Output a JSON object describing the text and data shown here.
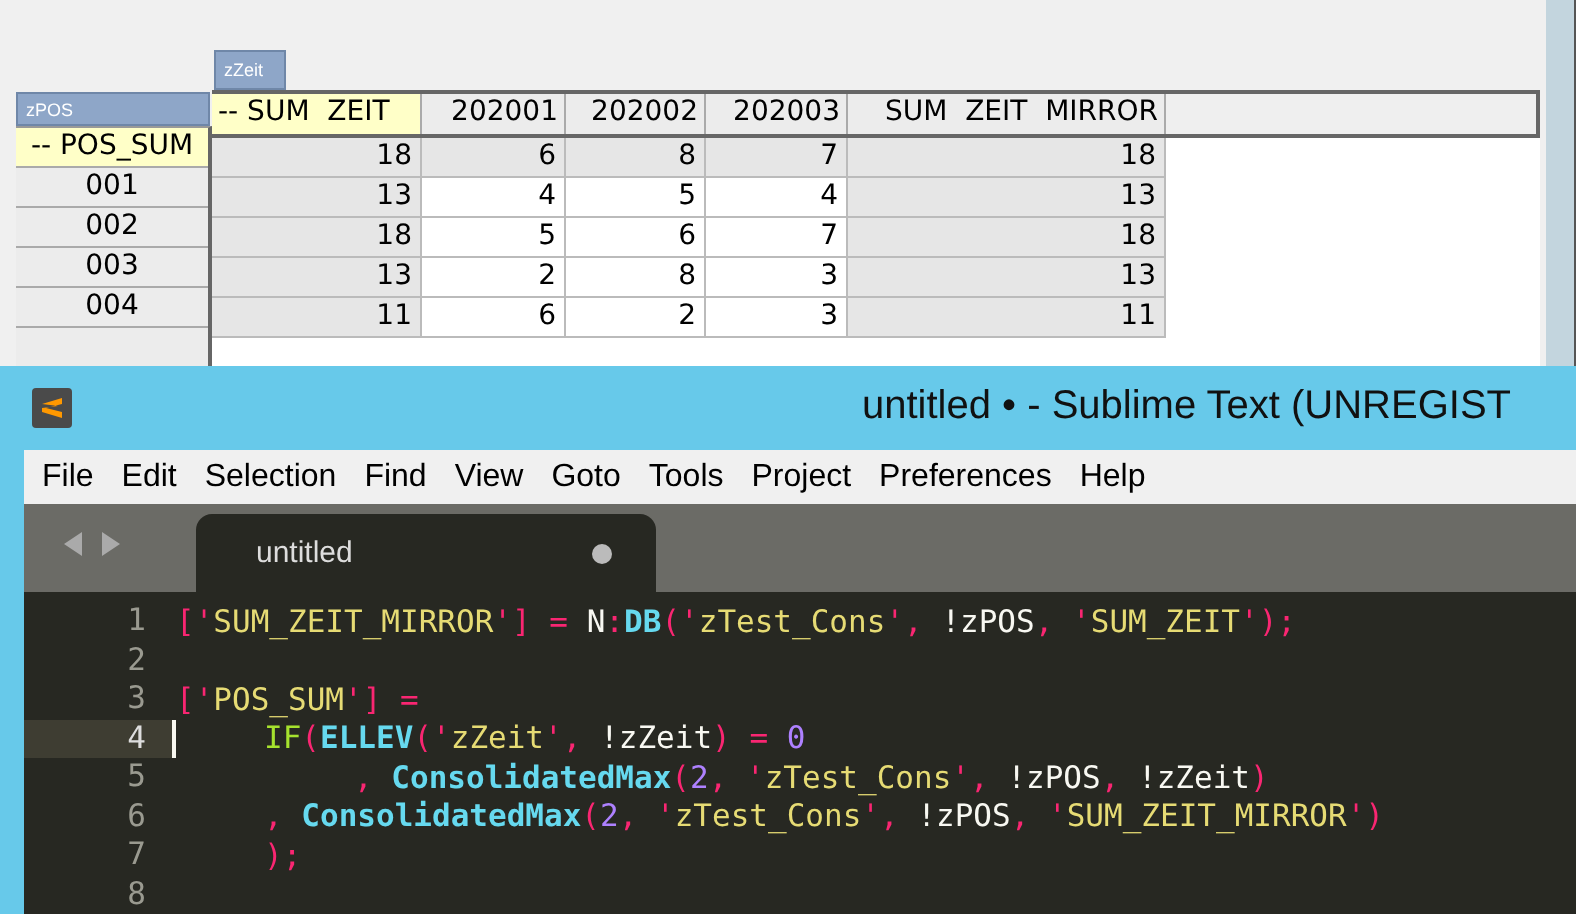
{
  "pivot": {
    "column_dimension": "zZeit",
    "row_dimension": "zPOS",
    "columns": [
      {
        "label": "-- SUM  ZEIT",
        "kind": "total"
      },
      {
        "label": "202001",
        "kind": "leaf"
      },
      {
        "label": "202002",
        "kind": "leaf"
      },
      {
        "label": "202003",
        "kind": "leaf"
      },
      {
        "label": "SUM  ZEIT  MIRROR",
        "kind": "mirror"
      }
    ],
    "rows": [
      {
        "label": "-- POS_SUM",
        "kind": "total",
        "cells": [
          "18",
          "6",
          "8",
          "7",
          "18"
        ]
      },
      {
        "label": "001",
        "kind": "leaf",
        "cells": [
          "13",
          "4",
          "5",
          "4",
          "13"
        ]
      },
      {
        "label": "002",
        "kind": "leaf",
        "cells": [
          "18",
          "5",
          "6",
          "7",
          "18"
        ]
      },
      {
        "label": "003",
        "kind": "leaf",
        "cells": [
          "13",
          "2",
          "8",
          "3",
          "13"
        ]
      },
      {
        "label": "004",
        "kind": "leaf",
        "cells": [
          "11",
          "6",
          "2",
          "3",
          "11"
        ]
      }
    ]
  },
  "editor": {
    "window": {
      "title": "untitled • - Sublime Text (UNREGIST"
    },
    "menu": [
      "File",
      "Edit",
      "Selection",
      "Find",
      "View",
      "Goto",
      "Tools",
      "Project",
      "Preferences",
      "Help"
    ],
    "tabs": [
      {
        "label": "untitled",
        "modified": true,
        "selected": true
      }
    ],
    "lines": [
      {
        "number": "1",
        "current": false,
        "kind": "top",
        "tokens": [
          {
            "t": "['",
            "kind": "punct"
          },
          {
            "t": "SUM_ZEIT_MIRROR",
            "kind": "string"
          },
          {
            "t": "'] = ",
            "kind": "punct"
          },
          {
            "t": "N",
            "kind": "plain"
          },
          {
            "t": ":",
            "kind": "punct"
          },
          {
            "t": "DB",
            "kind": "function"
          },
          {
            "t": "('",
            "kind": "punct"
          },
          {
            "t": "zTest_Cons",
            "kind": "string"
          },
          {
            "t": "', ",
            "kind": "punct"
          },
          {
            "t": "!zPOS",
            "kind": "plain"
          },
          {
            "t": ", '",
            "kind": "punct"
          },
          {
            "t": "SUM_ZEIT",
            "kind": "string"
          },
          {
            "t": "');",
            "kind": "punct"
          }
        ]
      },
      {
        "number": "2",
        "current": false
      },
      {
        "number": "3",
        "current": false,
        "kind": "top",
        "tokens": [
          {
            "t": "['",
            "kind": "punct"
          },
          {
            "t": "POS_SUM",
            "kind": "string"
          },
          {
            "t": "'] =",
            "kind": "punct"
          }
        ]
      },
      {
        "number": "4",
        "current": true,
        "kind": "nested",
        "tokens": [
          {
            "t": "IF",
            "kind": "keyword"
          },
          {
            "t": "(",
            "kind": "punct"
          },
          {
            "t": "ELLEV",
            "kind": "function"
          },
          {
            "t": "('",
            "kind": "punct"
          },
          {
            "t": "zZeit",
            "kind": "string"
          },
          {
            "t": "', ",
            "kind": "punct"
          },
          {
            "t": "!zZeit",
            "kind": "plain"
          },
          {
            "t": ") = ",
            "kind": "punct"
          },
          {
            "t": "0",
            "kind": "number"
          }
        ]
      },
      {
        "number": "5",
        "current": false,
        "kind": "deep",
        "tokens": [
          {
            "t": ", ",
            "kind": "punct"
          },
          {
            "t": "ConsolidatedMax",
            "kind": "function"
          },
          {
            "t": "(",
            "kind": "punct"
          },
          {
            "t": "2",
            "kind": "number"
          },
          {
            "t": ", '",
            "kind": "punct"
          },
          {
            "t": "zTest_Cons",
            "kind": "string"
          },
          {
            "t": "', ",
            "kind": "punct"
          },
          {
            "t": "!zPOS",
            "kind": "plain"
          },
          {
            "t": ", ",
            "kind": "punct"
          },
          {
            "t": "!zZeit",
            "kind": "plain"
          },
          {
            "t": ")",
            "kind": "punct"
          }
        ]
      },
      {
        "number": "6",
        "current": false,
        "kind": "nested",
        "tokens": [
          {
            "t": ", ",
            "kind": "punct"
          },
          {
            "t": "ConsolidatedMax",
            "kind": "function"
          },
          {
            "t": "(",
            "kind": "punct"
          },
          {
            "t": "2",
            "kind": "number"
          },
          {
            "t": ", '",
            "kind": "punct"
          },
          {
            "t": "zTest_Cons",
            "kind": "string"
          },
          {
            "t": "', ",
            "kind": "punct"
          },
          {
            "t": "!zPOS",
            "kind": "plain"
          },
          {
            "t": ", '",
            "kind": "punct"
          },
          {
            "t": "SUM_ZEIT_MIRROR",
            "kind": "string"
          },
          {
            "t": "')",
            "kind": "punct"
          }
        ]
      },
      {
        "number": "7",
        "current": false,
        "kind": "nested",
        "tokens": [
          {
            "t": ");",
            "kind": "punct"
          }
        ]
      },
      {
        "number": "8",
        "current": false
      }
    ]
  }
}
